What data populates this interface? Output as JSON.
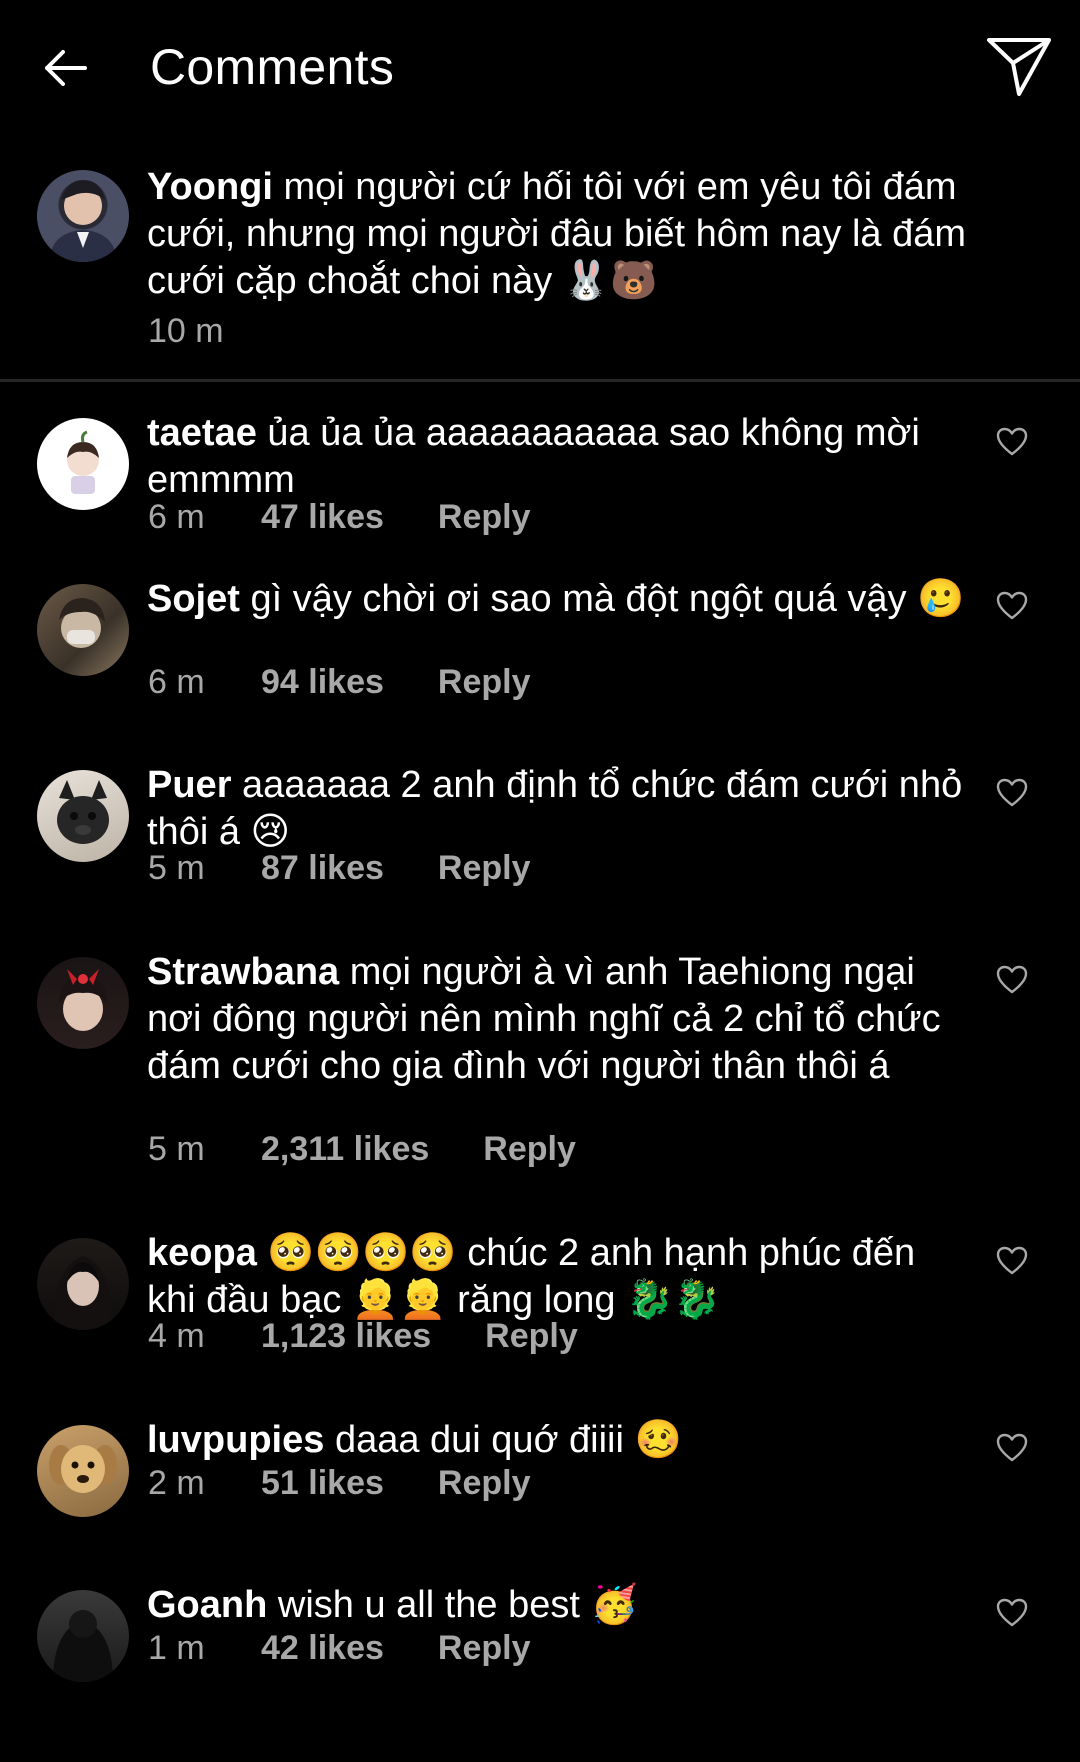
{
  "header": {
    "title": "Comments",
    "back_icon": "arrow-left-icon",
    "share_icon": "paper-plane-icon"
  },
  "caption": {
    "username": "Yoongi",
    "text": "mọi người cứ hối tôi với em yêu tôi đám cưới, nhưng mọi người đâu biết hôm nay là đám cưới cặp choắt choi này 🐰🐻",
    "time": "10 m"
  },
  "comments": [
    {
      "username": "taetae",
      "text": "ủa ủa ủa aaaaaaaaaaa sao không mời emmmm",
      "time": "6 m",
      "likes": "47 likes",
      "reply": "Reply"
    },
    {
      "username": "Sojet",
      "text": "gì vậy chời ơi sao mà đột ngột quá vậy 🥲",
      "time": "6 m",
      "likes": "94 likes",
      "reply": "Reply"
    },
    {
      "username": "Puer",
      "text": "aaaaaaa 2 anh định tổ chức đám cưới nhỏ thôi á 😢",
      "time": "5 m",
      "likes": "87 likes",
      "reply": "Reply"
    },
    {
      "username": "Strawbana",
      "text": "mọi người à vì anh Taehiong ngại nơi đông người nên mình nghĩ cả 2 chỉ tổ chức đám cưới cho gia đình với người thân thôi á",
      "time": "5 m",
      "likes": "2,311 likes",
      "reply": "Reply"
    },
    {
      "username": "keopa",
      "text": "🥺🥺🥺🥺 chúc 2 anh hạnh phúc đến khi đầu bạc 👱👱 răng long 🐉🐉",
      "time": "4 m",
      "likes": "1,123 likes",
      "reply": "Reply"
    },
    {
      "username": "luvpupies",
      "text": "daaa dui quớ điiii 🥴",
      "time": "2 m",
      "likes": "51 likes",
      "reply": "Reply"
    },
    {
      "username": "Goanh",
      "text": "wish u all the best 🥳",
      "time": "1 m",
      "likes": "42 likes",
      "reply": "Reply"
    }
  ],
  "colors": {
    "background": "#000000",
    "text": "#ffffff",
    "secondary": "#a8a8a8",
    "divider": "#262626"
  }
}
